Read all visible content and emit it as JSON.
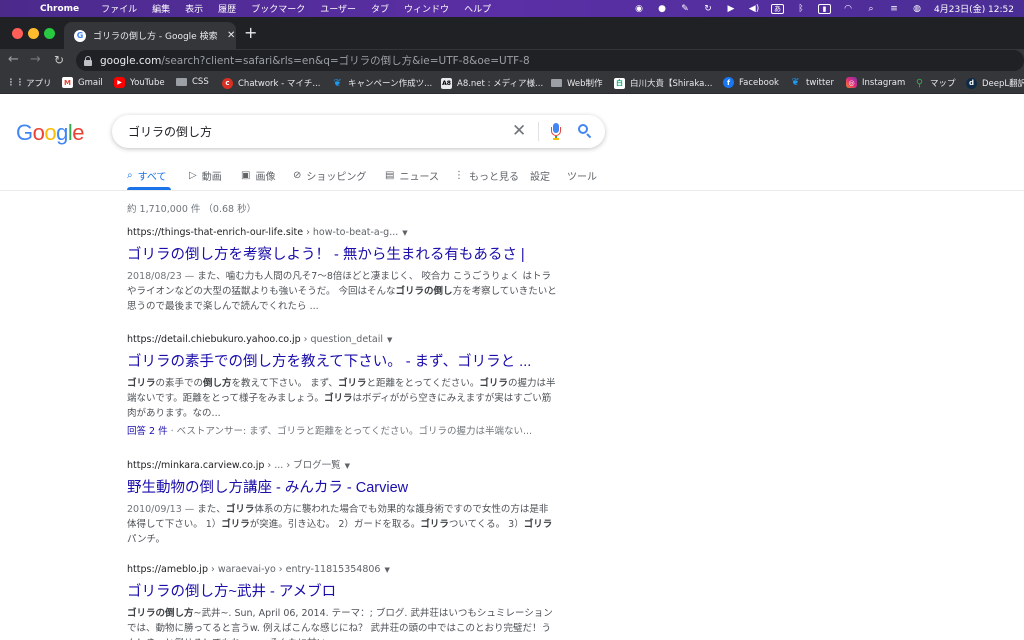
{
  "menubar": {
    "apple_glyph": "",
    "app_name": "Chrome",
    "items": [
      "ファイル",
      "編集",
      "表示",
      "履歴",
      "ブックマーク",
      "ユーザー",
      "タブ",
      "ウィンドウ",
      "ヘルプ"
    ],
    "status": {
      "input_source": "あ",
      "datetime": "4月23日(金)  12:52"
    }
  },
  "browser": {
    "tab": {
      "title": "ゴリラの倒し方 - Google 検索"
    },
    "url": {
      "host": "google.com",
      "path": "/search?client=safari&rls=en&q=ゴリラの倒し方&ie=UTF-8&oe=UTF-8"
    },
    "bookmarks": [
      {
        "label": "アプリ",
        "icon": "grid-icon"
      },
      {
        "label": "Gmail",
        "icon": "gmail-icon"
      },
      {
        "label": "YouTube",
        "icon": "youtube-icon"
      },
      {
        "label": "CSS",
        "icon": "folder-icon"
      },
      {
        "label": "Chatwork - マイチ...",
        "icon": "chatwork-icon"
      },
      {
        "label": "キャンペーン作成ツ...",
        "icon": "twitter-icon"
      },
      {
        "label": "A8.net : メディア様...",
        "icon": "a8-icon"
      },
      {
        "label": "Web制作",
        "icon": "folder-icon"
      },
      {
        "label": "白川大貴【Shiraka...",
        "icon": "site-icon"
      },
      {
        "label": "Facebook",
        "icon": "facebook-icon"
      },
      {
        "label": "twitter",
        "icon": "twitter-icon"
      },
      {
        "label": "Instagram",
        "icon": "instagram-icon"
      },
      {
        "label": "マップ",
        "icon": "maps-icon"
      },
      {
        "label": "DeepL翻訳",
        "icon": "deepl-icon"
      }
    ]
  },
  "google": {
    "logo": "Google",
    "query": "ゴリラの倒し方",
    "tabs": [
      "すべて",
      "動画",
      "画像",
      "ショッピング",
      "ニュース",
      "もっと見る",
      "設定",
      "ツール"
    ],
    "stats": "約 1,710,000 件  （0.68 秒）",
    "results": [
      {
        "url": "https://things-that-enrich-our-life.site",
        "crumb": " › how-to-beat-a-g...",
        "title": "ゴリラの倒し方を考察しよう！ - 無から生まれる有もあるさ |",
        "date": "2018/08/23 — ",
        "snippet_html": "また、噛む力も人間の凡そ7〜8倍ほどと凄まじく、 咬合力 こうごうりょく はトラやライオンなどの大型の猛獣よりも強いそうだ。 今回はそんな<b>ゴリラの倒し</b>方を考察していきたいと思うので最後まで楽しんで読んでくれたら ...",
        "extra_link": "",
        "extra_text": ""
      },
      {
        "url": "https://detail.chiebukuro.yahoo.co.jp",
        "crumb": " › question_detail",
        "title": "ゴリラの素手での倒し方を教えて下さい。 - まず、ゴリラと ...",
        "date": "",
        "snippet_html": "<b>ゴリラ</b>の素手での<b>倒し方</b>を教えて下さい。 まず、<b>ゴリラ</b>と距離をとってください。<b>ゴリラ</b>の握力は半端ないです。距離をとって様子をみましょう。<b>ゴリラ</b>はボディががら空きにみえますが実はすごい筋肉があります。なの...",
        "extra_link": "回答 2 件",
        "extra_text": " · ベストアンサー: まず、ゴリラと距離をとってください。ゴリラの握力は半端ない..."
      },
      {
        "url": "https://minkara.carview.co.jp",
        "crumb": " › ... › ブログ一覧",
        "title": "野生動物の倒し方講座 - みんカラ - Carview",
        "date": "2010/09/13 — ",
        "snippet_html": "また、<b>ゴリラ</b>体系の方に襲われた場合でも効果的な護身術ですので女性の方は是非体得して下さい。 1）<b>ゴリラ</b>が突進。引き込む。 2）ガードを取る。<b>ゴリラ</b>ついてくる。 3）<b>ゴリラ</b>パンチ。",
        "extra_link": "",
        "extra_text": ""
      },
      {
        "url": "https://ameblo.jp",
        "crumb": " › waraevai-yo › entry-11815354806",
        "title": "ゴリラの倒し方~武井 - アメブロ",
        "date": "",
        "snippet_html": "<b>ゴリラの倒し方</b>~武井~. Sun, April 06, 2014. テーマ：; ブログ. 武井荘はいつもシュミレーションでは、動物に勝ってると言うw. 例えばこんな感じにね？ 武井荘の頭の中ではこのとおり完璧だ！うん！きっと倒せる！でもね・・・そんなに甘い",
        "extra_link": "",
        "extra_text": ""
      }
    ]
  }
}
